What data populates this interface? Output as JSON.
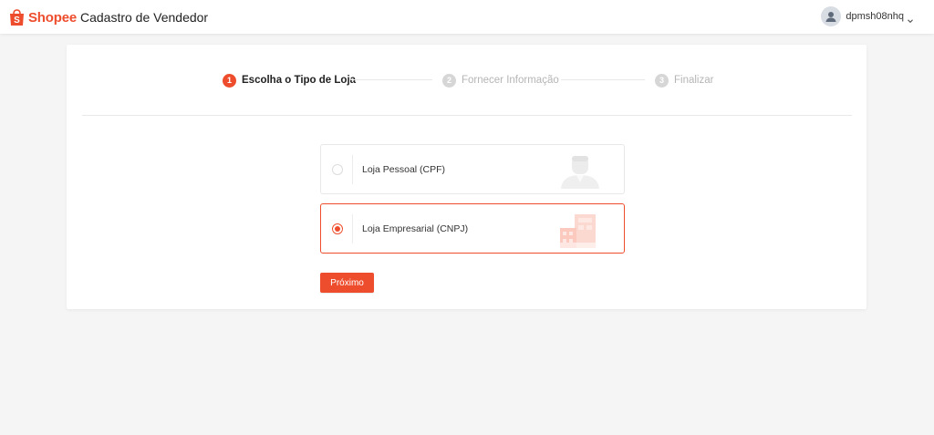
{
  "header": {
    "brand": "Shopee",
    "portal_title": "Cadastro de Vendedor",
    "username": "dpmsh08nhq",
    "logo_icon": "shopee-bag-icon",
    "avatar_icon": "user-avatar-icon",
    "dropdown_icon": "chevron-down-icon"
  },
  "stepper": {
    "steps": [
      {
        "number": "1",
        "label": "Escolha o Tipo de Loja",
        "state": "active"
      },
      {
        "number": "2",
        "label": "Fornecer Informação",
        "state": "inactive"
      },
      {
        "number": "3",
        "label": "Finalizar",
        "state": "inactive"
      }
    ]
  },
  "shop_type": {
    "options": [
      {
        "label": "Loja Pessoal (CPF)",
        "selected": false,
        "illustration": "person-illustration-icon"
      },
      {
        "label": "Loja Empresarial (CNPJ)",
        "selected": true,
        "illustration": "buildings-illustration-icon"
      }
    ]
  },
  "next_button": {
    "label": "Próximo"
  },
  "colors": {
    "accent": "#ee4d2d",
    "page_background": "#f5f5f5",
    "inactive_step": "#d6d6d6"
  }
}
